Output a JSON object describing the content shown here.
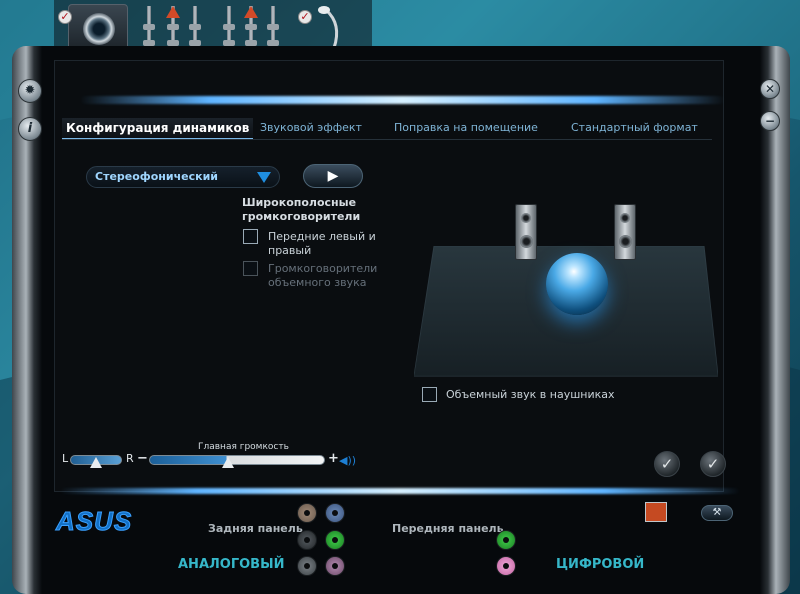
{
  "tabs": [
    {
      "label": "Конфигурация динамиков",
      "active": true
    },
    {
      "label": "Звуковой эффект",
      "active": false
    },
    {
      "label": "Поправка на помещение",
      "active": false
    },
    {
      "label": "Стандартный формат",
      "active": false
    }
  ],
  "speaker_config": {
    "selected": "Стереофонический",
    "play_icon": "play-icon"
  },
  "fullrange": {
    "title": "Широкополосные громкоговорители",
    "front_label": "Передние левый и правый",
    "front_checked": false,
    "surround_label": "Громкоговорители объемного звука",
    "surround_checked": false,
    "surround_enabled": false
  },
  "headphone_virtualization": {
    "label": "Объемный звук в наушниках",
    "checked": false
  },
  "volume": {
    "label": "Главная громкость",
    "left": "L",
    "right": "R",
    "minus": "−",
    "plus": "+",
    "balance": 0.5,
    "level": 0.44
  },
  "connectors": {
    "rear_label": "Задняя панель",
    "front_label": "Передняя панель",
    "analog_label": "АНАЛОГОВЫЙ",
    "digital_label": "ЦИФРОВОЙ"
  },
  "brand": "ASUS",
  "colors": {
    "accent": "#36b7c9",
    "tab_text": "#7fb4d6",
    "slider_fill": "#3f8fd0"
  }
}
